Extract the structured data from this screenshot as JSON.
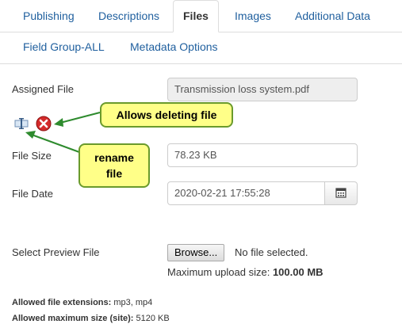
{
  "tabs": [
    {
      "label": "Publishing"
    },
    {
      "label": "Descriptions"
    },
    {
      "label": "Files",
      "active": true
    },
    {
      "label": "Images"
    },
    {
      "label": "Additional Data"
    },
    {
      "label": "Field Group-ALL"
    },
    {
      "label": "Metadata Options"
    }
  ],
  "form": {
    "assigned_file_label": "Assigned File",
    "assigned_file_value": "Transmission loss system.pdf",
    "file_size_label": "File Size",
    "file_size_value": "78.23 KB",
    "file_date_label": "File Date",
    "file_date_value": "2020-02-21 17:55:28",
    "preview_label": "Select Preview File",
    "browse_label": "Browse...",
    "no_file_text": "No file selected.",
    "max_upload_prefix": "Maximum upload size:",
    "max_upload_value": "100.00 MB",
    "allowed_ext_label": "Allowed file extensions:",
    "allowed_ext_value": "mp3, mp4",
    "allowed_max_label": "Allowed maximum size (site):",
    "allowed_max_value": "5120 KB"
  },
  "callouts": {
    "delete": "Allows deleting file",
    "rename_line1": "rename",
    "rename_line2": "file"
  },
  "icons": {
    "rename": "rename-icon",
    "delete": "delete-icon",
    "calendar": "calendar-icon"
  },
  "colors": {
    "link": "#1f5f9e",
    "callout_bg": "#ffff88",
    "callout_border": "#6a9a2c",
    "arrow": "#2e8b2e",
    "delete": "#d42a2a"
  }
}
